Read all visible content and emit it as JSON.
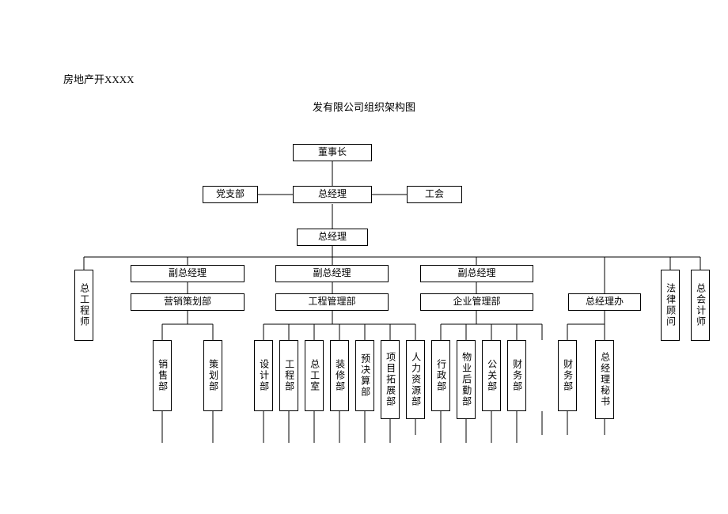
{
  "header_line1": "房地产开XXXX",
  "title": "发有限公司组织架构图",
  "nodes": {
    "chairman": "董事长",
    "party": "党支部",
    "gm_top": "总经理",
    "union": "工会",
    "gm_sub": "总经理",
    "vgm1": "副总经理",
    "vgm2": "副总经理",
    "vgm3": "副总经理",
    "chief_eng": "总工程师",
    "legal": "法律顾问",
    "chief_acc": "总会计师",
    "mkt_plan": "营销策划部",
    "eng_mgmt": "工程管理部",
    "corp_mgmt": "企业管理部",
    "gm_office": "总经理办",
    "sales": "销售部",
    "planning": "策划部",
    "design": "设计部",
    "engineering": "工程部",
    "chief_room": "总工室",
    "decoration": "装修部",
    "budget": "预决算部",
    "project_exp": "项目拓展部",
    "hr": "人力资源部",
    "admin": "行政部",
    "property": "物业后勤部",
    "pr": "公关部",
    "finance": "财务部",
    "gm_secretary": "总经理秘书"
  }
}
